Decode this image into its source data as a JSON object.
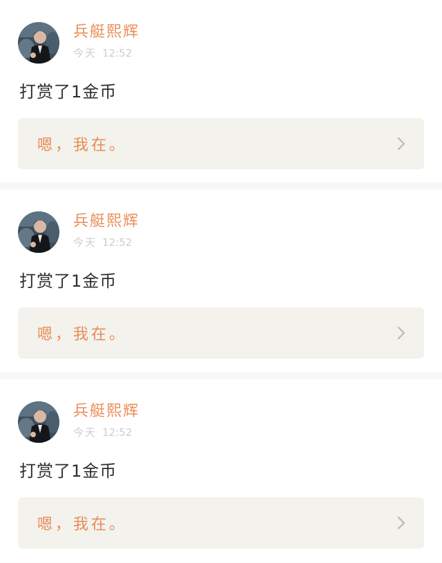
{
  "entries": [
    {
      "username": "兵艇熙辉",
      "time_day": "今天",
      "time_clock": "12:52",
      "action": "打赏了1金币",
      "quote": "嗯，我在。",
      "icons": {
        "avatar": "avatar",
        "chevron": "chevron-right-icon"
      }
    },
    {
      "username": "兵艇熙辉",
      "time_day": "今天",
      "time_clock": "12:52",
      "action": "打赏了1金币",
      "quote": "嗯，我在。",
      "icons": {
        "avatar": "avatar",
        "chevron": "chevron-right-icon"
      }
    },
    {
      "username": "兵艇熙辉",
      "time_day": "今天",
      "time_clock": "12:52",
      "action": "打赏了1金币",
      "quote": "嗯，我在。",
      "icons": {
        "avatar": "avatar",
        "chevron": "chevron-right-icon"
      }
    }
  ],
  "colors": {
    "accent": "#ea8e59",
    "quote_bg": "#f3f2ed",
    "separator": "#f7f7f7",
    "text": "#2e2e2e",
    "muted": "#cdcdcd"
  }
}
